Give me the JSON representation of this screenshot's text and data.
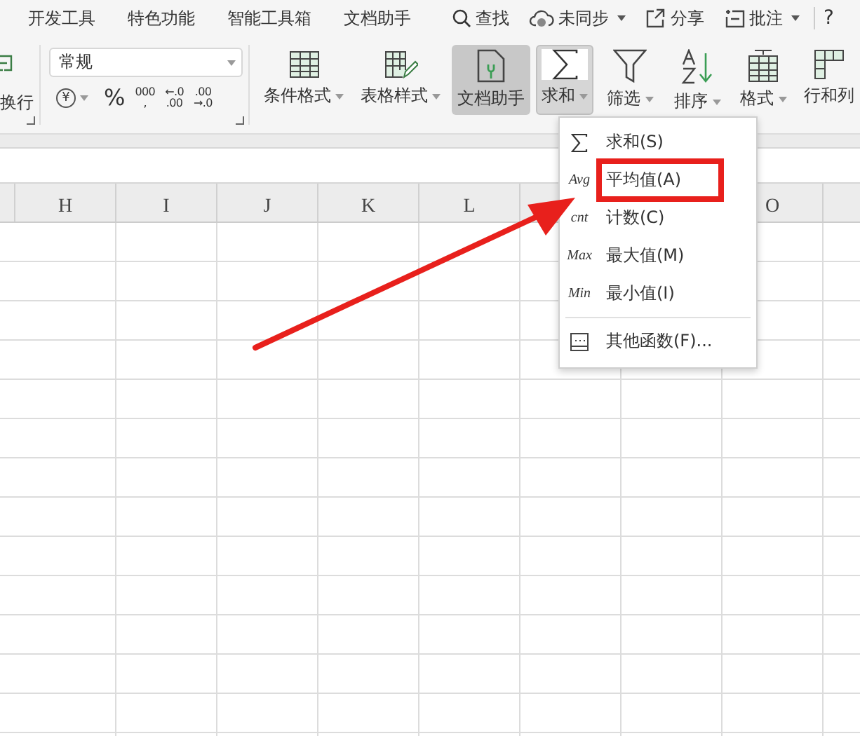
{
  "menu_tabs": [
    {
      "label": "开发工具"
    },
    {
      "label": "特色功能"
    },
    {
      "label": "智能工具箱"
    },
    {
      "label": "文档助手"
    }
  ],
  "top_actions": [
    {
      "kind": "search",
      "label": "查找",
      "dropdown": false
    },
    {
      "kind": "sync",
      "label": "未同步",
      "dropdown": true
    },
    {
      "kind": "share",
      "label": "分享",
      "dropdown": false
    },
    {
      "kind": "comment",
      "label": "批注",
      "dropdown": true
    }
  ],
  "help": "?",
  "ribbon": {
    "wrap_label": "换行",
    "number_format": {
      "value": "常规"
    },
    "number_buttons": [
      {
        "kind": "currency",
        "label": "¥",
        "dropdown": true
      },
      {
        "kind": "percent",
        "label": "%"
      },
      {
        "kind": "thousands",
        "label": "000",
        "sub": ","
      },
      {
        "kind": "decimal",
        "top": "←.0",
        "bottom": ".00"
      },
      {
        "kind": "decimal",
        "top": ".00",
        "bottom": "→.0"
      }
    ],
    "buttons": [
      {
        "kind": "grid",
        "label": "条件格式",
        "dropdown": true,
        "selected": false,
        "pressed": false
      },
      {
        "kind": "grid-pen",
        "label": "表格样式",
        "dropdown": true,
        "selected": false,
        "pressed": false
      },
      {
        "kind": "doc",
        "label": "文档助手",
        "dropdown": false,
        "selected": true,
        "pressed": false
      },
      {
        "kind": "sigma",
        "label": "求和",
        "dropdown": true,
        "selected": false,
        "pressed": true
      },
      {
        "kind": "filter",
        "label": "筛选",
        "dropdown": true,
        "selected": false,
        "pressed": false
      },
      {
        "kind": "sort",
        "label": "排序",
        "dropdown": true,
        "selected": false,
        "pressed": false
      },
      {
        "kind": "format",
        "label": "格式",
        "dropdown": true,
        "selected": false,
        "pressed": false
      },
      {
        "kind": "rowcol",
        "label": "行和列",
        "dropdown": false,
        "selected": false,
        "pressed": false
      }
    ]
  },
  "columns_left": [
    "H",
    "I",
    "J",
    "K",
    "L"
  ],
  "columns_right": [
    "O"
  ],
  "sum_menu": {
    "items": [
      {
        "kind": "sigma",
        "label": "求和(S)",
        "highlighted": false
      },
      {
        "kind": "text",
        "icon_text": "Avg",
        "label": "平均值(A)",
        "highlighted": true
      },
      {
        "kind": "text",
        "icon_text": "cnt",
        "label": "计数(C)",
        "highlighted": false
      },
      {
        "kind": "text",
        "icon_text": "Max",
        "label": "最大值(M)",
        "highlighted": false
      },
      {
        "kind": "text",
        "icon_text": "Min",
        "label": "最小值(I)",
        "highlighted": false
      },
      {
        "kind": "separator"
      },
      {
        "kind": "dialog",
        "label": "其他函数(F)...",
        "highlighted": false
      }
    ],
    "arrow_to_highlight": true
  }
}
